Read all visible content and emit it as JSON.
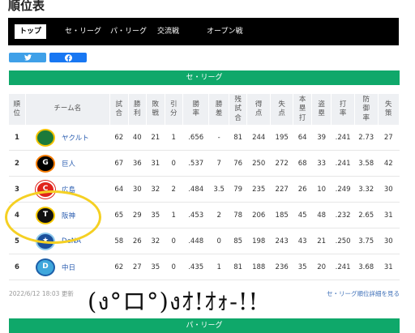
{
  "page_title": "順位表",
  "tabs": [
    {
      "label": "トップ",
      "active": true
    },
    {
      "label": "セ・リーグ",
      "active": false
    },
    {
      "label": "パ・リーグ",
      "active": false
    },
    {
      "label": "交流戦",
      "active": false
    },
    {
      "label": "オープン戦",
      "active": false
    }
  ],
  "share": {
    "twitter_icon": "twitter-bird-icon",
    "facebook_icon": "facebook-f-icon"
  },
  "league_banner": "セ・リーグ",
  "next_banner": "パ・リーグ",
  "colors": {
    "banner_green": "#0fa86a",
    "tab_bar": "#000000",
    "header_bg": "#eef0f3",
    "link_blue": "#2a5db0",
    "circle_yellow": "#f5d023"
  },
  "table": {
    "headers": [
      "順位",
      "チーム名",
      "試合",
      "勝利",
      "敗戦",
      "引分",
      "勝率",
      "勝差",
      "残試合",
      "得点",
      "失点",
      "本塁打",
      "盗塁",
      "打率",
      "防御率",
      "失策"
    ],
    "rows": [
      {
        "rank": "1",
        "team": "ヤクルト",
        "logo": "swallows-logo",
        "stats": [
          "62",
          "40",
          "21",
          "1",
          ".656",
          "-",
          "81",
          "244",
          "195",
          "64",
          "39",
          ".241",
          "2.73",
          "27"
        ]
      },
      {
        "rank": "2",
        "team": "巨人",
        "logo": "giants-logo",
        "stats": [
          "67",
          "36",
          "31",
          "0",
          ".537",
          "7",
          "76",
          "250",
          "272",
          "68",
          "33",
          ".241",
          "3.58",
          "42"
        ]
      },
      {
        "rank": "3",
        "team": "広島",
        "logo": "carp-logo",
        "stats": [
          "64",
          "30",
          "32",
          "2",
          ".484",
          "3.5",
          "79",
          "235",
          "227",
          "26",
          "10",
          ".249",
          "3.32",
          "30"
        ]
      },
      {
        "rank": "4",
        "team": "阪神",
        "logo": "tigers-logo",
        "stats": [
          "65",
          "29",
          "35",
          "1",
          ".453",
          "2",
          "78",
          "206",
          "185",
          "45",
          "48",
          ".232",
          "2.65",
          "31"
        ]
      },
      {
        "rank": "5",
        "team": "DeNA",
        "logo": "baystars-logo",
        "stats": [
          "58",
          "26",
          "32",
          "0",
          ".448",
          "0",
          "85",
          "198",
          "243",
          "43",
          "21",
          ".250",
          "3.75",
          "30"
        ]
      },
      {
        "rank": "6",
        "team": "中日",
        "logo": "dragons-logo",
        "stats": [
          "62",
          "27",
          "35",
          "0",
          ".435",
          "1",
          "81",
          "188",
          "236",
          "35",
          "20",
          ".241",
          "3.68",
          "31"
        ]
      }
    ]
  },
  "updated": "2022/6/12 18:03 更新",
  "detail_link": "セ・リーグ順位詳細を見る",
  "annotation": "(ง°ロ°)งｵ!ｵｫ-!!"
}
